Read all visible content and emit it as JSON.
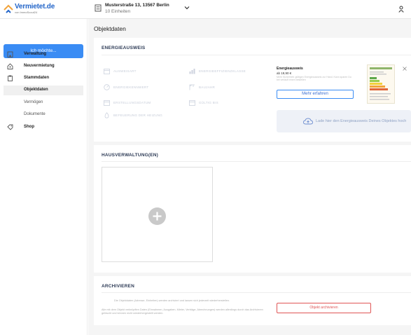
{
  "app": {
    "brand": "Vermietet.de",
    "brand_sub": "von ImmoScout24"
  },
  "property": {
    "address": "Musterstraße 13, 13567 Berlin",
    "units": "10 Einheiten"
  },
  "sidebar": {
    "cta": "Ich möchte...",
    "items": [
      {
        "label": "Verwaltung",
        "icon": "building-icon"
      },
      {
        "label": "Neuvermietung",
        "icon": "house-key-icon"
      },
      {
        "label": "Stammdaten",
        "icon": "clipboard-icon"
      },
      {
        "label": "Objektdaten"
      },
      {
        "label": "Vermögen"
      },
      {
        "label": "Dokumente"
      },
      {
        "label": "Shop",
        "icon": "tag-icon"
      }
    ]
  },
  "page": {
    "title": "Objektdaten"
  },
  "energieausweis": {
    "title": "ENERGIEAUSWEIS",
    "fields": [
      "AUSWEISART",
      "ENERGIEKENNWERT",
      "ENERGIEEFFIZIENZKLASSE",
      "BAUJAHR",
      "ERSTELLUNGSDATUM",
      "GÜLTIG BIS",
      "BEFEUERUNG DER HEIZUNG"
    ],
    "promo": {
      "title": "Energieausweis",
      "price": "ab 19,90 €",
      "desc": "Mehr Sicherheit: gültigen Energieausweis zur Hand. Kann sparen Du bei verläuft einen bestellen",
      "button": "Mehr erfahren"
    },
    "upload": "Lade hier den Energieausweis Deines Objektes hoch"
  },
  "hausverwaltung": {
    "title": "HAUSVERWALTUNG(EN)"
  },
  "archivieren": {
    "title": "ARCHIVIEREN",
    "text1": "Die Objektdaten (Adresse, Einheiten) werden archiviert und lassen sich jederzeit wiederherstellen.",
    "text2": "Alle mit dem Objekt verknüpften Daten (Einnahmen, Ausgaben, Mieter, Verträge, Abrechnungen) werden allerdings durch das Archivieren gelöscht und können nicht wiederhergestellt werden.",
    "button": "Objekt archivieren"
  },
  "colors": {
    "accent": "#3a8cf4",
    "danger": "#e05555",
    "heading": "#2c3a55"
  }
}
